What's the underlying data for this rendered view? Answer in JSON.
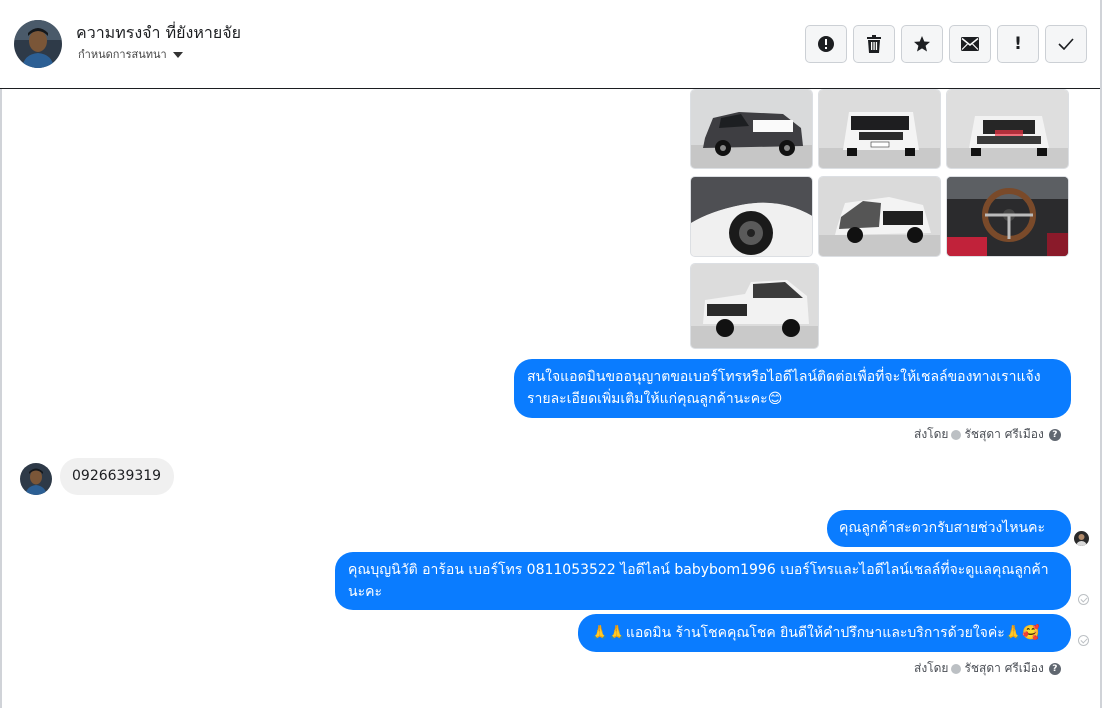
{
  "header": {
    "contact_name": "ความทรงจำ ที่ยังหายจัย",
    "assign_label": "กำหนดการสนทนา",
    "actions": [
      {
        "icon": "alert-circle-icon",
        "label": ""
      },
      {
        "icon": "trash-icon",
        "label": ""
      },
      {
        "icon": "star-icon",
        "label": ""
      },
      {
        "icon": "envelope-icon",
        "label": ""
      },
      {
        "icon": "exclamation-icon",
        "label": "!"
      },
      {
        "icon": "checkmark-icon",
        "label": ""
      }
    ]
  },
  "messages": {
    "m1_text": "สนใจแอดมินขออนุญาตขอเบอร์โทรหรือไอดีไลน์ติดต่อเพื่อที่จะให้เชลล์ของทางเราแจ้งรายละเอียดเพิ่มเติมให้แก่คุณลูกค้านะคะ😊",
    "sent_by_label": "ส่งโดย",
    "sender_name": "รัชสุดา ศรีเมือง",
    "help_mark": "?",
    "m2_text": "0926639319",
    "m3_text": "คุณลูกค้าสะดวกรับสายช่วงไหนคะ",
    "m4_text": "คุณบุญนิวัติ  อาร้อน        เบอร์โทร 0811053522  ไอดีไลน์ babybom1996   เบอร์โทรและไอดีไลน์เชลล์ที่จะดูแลคุณลูกค้านะคะ",
    "m5_text": "🙏🙏แอดมิน ร้านโชคคุณโชค ยินดีให้คำปรึกษาและบริการด้วยใจค่ะ🙏🥰"
  },
  "colors": {
    "outgoing_bubble": "#0a7cff",
    "incoming_bubble": "#f0f0f0"
  }
}
